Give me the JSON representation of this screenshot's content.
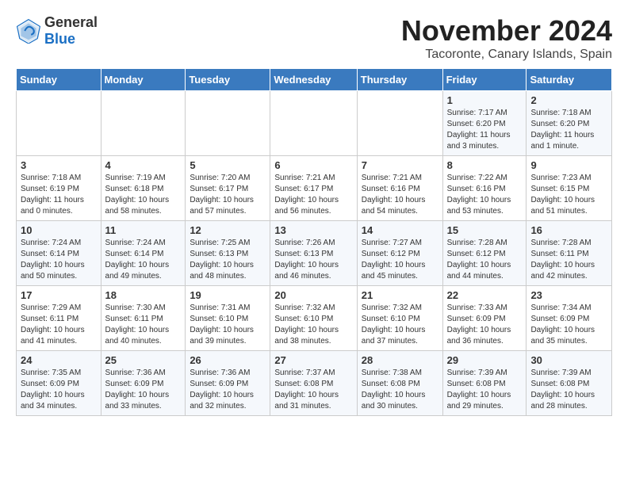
{
  "header": {
    "logo_general": "General",
    "logo_blue": "Blue",
    "month_title": "November 2024",
    "subtitle": "Tacoronte, Canary Islands, Spain"
  },
  "weekdays": [
    "Sunday",
    "Monday",
    "Tuesday",
    "Wednesday",
    "Thursday",
    "Friday",
    "Saturday"
  ],
  "rows": [
    [
      {
        "day": "",
        "lines": []
      },
      {
        "day": "",
        "lines": []
      },
      {
        "day": "",
        "lines": []
      },
      {
        "day": "",
        "lines": []
      },
      {
        "day": "",
        "lines": []
      },
      {
        "day": "1",
        "lines": [
          "Sunrise: 7:17 AM",
          "Sunset: 6:20 PM",
          "Daylight: 11 hours",
          "and 3 minutes."
        ]
      },
      {
        "day": "2",
        "lines": [
          "Sunrise: 7:18 AM",
          "Sunset: 6:20 PM",
          "Daylight: 11 hours",
          "and 1 minute."
        ]
      }
    ],
    [
      {
        "day": "3",
        "lines": [
          "Sunrise: 7:18 AM",
          "Sunset: 6:19 PM",
          "Daylight: 11 hours",
          "and 0 minutes."
        ]
      },
      {
        "day": "4",
        "lines": [
          "Sunrise: 7:19 AM",
          "Sunset: 6:18 PM",
          "Daylight: 10 hours",
          "and 58 minutes."
        ]
      },
      {
        "day": "5",
        "lines": [
          "Sunrise: 7:20 AM",
          "Sunset: 6:17 PM",
          "Daylight: 10 hours",
          "and 57 minutes."
        ]
      },
      {
        "day": "6",
        "lines": [
          "Sunrise: 7:21 AM",
          "Sunset: 6:17 PM",
          "Daylight: 10 hours",
          "and 56 minutes."
        ]
      },
      {
        "day": "7",
        "lines": [
          "Sunrise: 7:21 AM",
          "Sunset: 6:16 PM",
          "Daylight: 10 hours",
          "and 54 minutes."
        ]
      },
      {
        "day": "8",
        "lines": [
          "Sunrise: 7:22 AM",
          "Sunset: 6:16 PM",
          "Daylight: 10 hours",
          "and 53 minutes."
        ]
      },
      {
        "day": "9",
        "lines": [
          "Sunrise: 7:23 AM",
          "Sunset: 6:15 PM",
          "Daylight: 10 hours",
          "and 51 minutes."
        ]
      }
    ],
    [
      {
        "day": "10",
        "lines": [
          "Sunrise: 7:24 AM",
          "Sunset: 6:14 PM",
          "Daylight: 10 hours",
          "and 50 minutes."
        ]
      },
      {
        "day": "11",
        "lines": [
          "Sunrise: 7:24 AM",
          "Sunset: 6:14 PM",
          "Daylight: 10 hours",
          "and 49 minutes."
        ]
      },
      {
        "day": "12",
        "lines": [
          "Sunrise: 7:25 AM",
          "Sunset: 6:13 PM",
          "Daylight: 10 hours",
          "and 48 minutes."
        ]
      },
      {
        "day": "13",
        "lines": [
          "Sunrise: 7:26 AM",
          "Sunset: 6:13 PM",
          "Daylight: 10 hours",
          "and 46 minutes."
        ]
      },
      {
        "day": "14",
        "lines": [
          "Sunrise: 7:27 AM",
          "Sunset: 6:12 PM",
          "Daylight: 10 hours",
          "and 45 minutes."
        ]
      },
      {
        "day": "15",
        "lines": [
          "Sunrise: 7:28 AM",
          "Sunset: 6:12 PM",
          "Daylight: 10 hours",
          "and 44 minutes."
        ]
      },
      {
        "day": "16",
        "lines": [
          "Sunrise: 7:28 AM",
          "Sunset: 6:11 PM",
          "Daylight: 10 hours",
          "and 42 minutes."
        ]
      }
    ],
    [
      {
        "day": "17",
        "lines": [
          "Sunrise: 7:29 AM",
          "Sunset: 6:11 PM",
          "Daylight: 10 hours",
          "and 41 minutes."
        ]
      },
      {
        "day": "18",
        "lines": [
          "Sunrise: 7:30 AM",
          "Sunset: 6:11 PM",
          "Daylight: 10 hours",
          "and 40 minutes."
        ]
      },
      {
        "day": "19",
        "lines": [
          "Sunrise: 7:31 AM",
          "Sunset: 6:10 PM",
          "Daylight: 10 hours",
          "and 39 minutes."
        ]
      },
      {
        "day": "20",
        "lines": [
          "Sunrise: 7:32 AM",
          "Sunset: 6:10 PM",
          "Daylight: 10 hours",
          "and 38 minutes."
        ]
      },
      {
        "day": "21",
        "lines": [
          "Sunrise: 7:32 AM",
          "Sunset: 6:10 PM",
          "Daylight: 10 hours",
          "and 37 minutes."
        ]
      },
      {
        "day": "22",
        "lines": [
          "Sunrise: 7:33 AM",
          "Sunset: 6:09 PM",
          "Daylight: 10 hours",
          "and 36 minutes."
        ]
      },
      {
        "day": "23",
        "lines": [
          "Sunrise: 7:34 AM",
          "Sunset: 6:09 PM",
          "Daylight: 10 hours",
          "and 35 minutes."
        ]
      }
    ],
    [
      {
        "day": "24",
        "lines": [
          "Sunrise: 7:35 AM",
          "Sunset: 6:09 PM",
          "Daylight: 10 hours",
          "and 34 minutes."
        ]
      },
      {
        "day": "25",
        "lines": [
          "Sunrise: 7:36 AM",
          "Sunset: 6:09 PM",
          "Daylight: 10 hours",
          "and 33 minutes."
        ]
      },
      {
        "day": "26",
        "lines": [
          "Sunrise: 7:36 AM",
          "Sunset: 6:09 PM",
          "Daylight: 10 hours",
          "and 32 minutes."
        ]
      },
      {
        "day": "27",
        "lines": [
          "Sunrise: 7:37 AM",
          "Sunset: 6:08 PM",
          "Daylight: 10 hours",
          "and 31 minutes."
        ]
      },
      {
        "day": "28",
        "lines": [
          "Sunrise: 7:38 AM",
          "Sunset: 6:08 PM",
          "Daylight: 10 hours",
          "and 30 minutes."
        ]
      },
      {
        "day": "29",
        "lines": [
          "Sunrise: 7:39 AM",
          "Sunset: 6:08 PM",
          "Daylight: 10 hours",
          "and 29 minutes."
        ]
      },
      {
        "day": "30",
        "lines": [
          "Sunrise: 7:39 AM",
          "Sunset: 6:08 PM",
          "Daylight: 10 hours",
          "and 28 minutes."
        ]
      }
    ]
  ]
}
